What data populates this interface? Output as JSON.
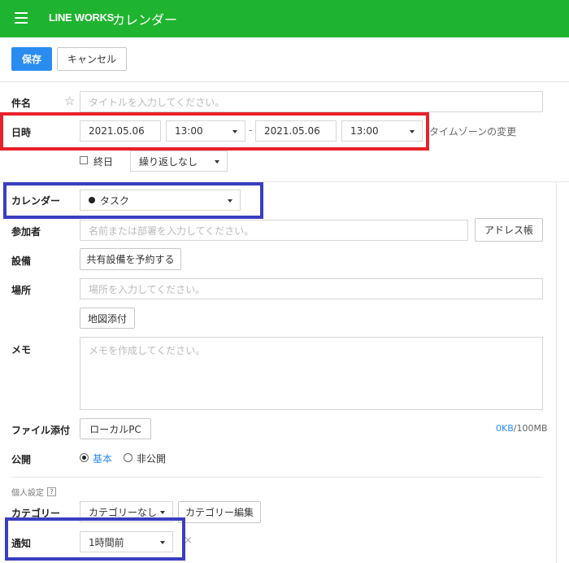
{
  "header": {
    "brand": "LINE WORKS",
    "title": "カレンダー",
    "colors": {
      "bar": "#1fb42f",
      "primary": "#2a8cf0",
      "highlight_red": "#e8212b",
      "highlight_blue": "#3a3ec2"
    }
  },
  "toolbar": {
    "save_label": "保存",
    "cancel_label": "キャンセル"
  },
  "form": {
    "subject": {
      "label": "件名",
      "placeholder": "タイトルを入力してください。"
    },
    "datetime": {
      "label": "日時",
      "start_date": "2021.05.06",
      "start_time": "13:00",
      "separator": "-",
      "end_date": "2021.05.06",
      "end_time": "13:00",
      "timezone_link": "タイムゾーンの変更",
      "all_day_label": "終日",
      "repeat_value": "繰り返しなし"
    },
    "calendar": {
      "label": "カレンダー",
      "value": "タスク"
    },
    "participants": {
      "label": "参加者",
      "placeholder": "名前または部署を入力してください。",
      "address_book": "アドレス帳"
    },
    "equipment": {
      "label": "設備",
      "button": "共有設備を予約する"
    },
    "location": {
      "label": "場所",
      "placeholder": "場所を入力してください。",
      "map_button": "地図添付"
    },
    "memo": {
      "label": "メモ",
      "placeholder": "メモを作成してください。"
    },
    "attachment": {
      "label": "ファイル添付",
      "button": "ローカルPC",
      "usage_used": "0KB",
      "usage_total": "/100MB"
    },
    "visibility": {
      "label": "公開",
      "option_basic": "基本",
      "option_private": "非公開",
      "selected": "基本"
    },
    "personal": {
      "section_label": "個人設定",
      "help": "?",
      "category": {
        "label": "カテゴリー",
        "value": "カテゴリーなし",
        "edit_button": "カテゴリー編集"
      },
      "notification": {
        "label": "通知",
        "value": "1時間前",
        "remove": "×"
      }
    }
  }
}
